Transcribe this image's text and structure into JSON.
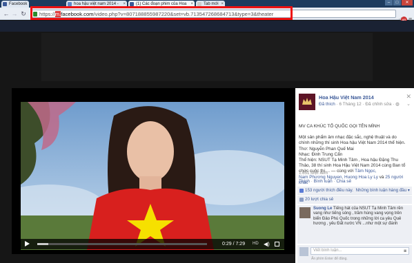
{
  "browser": {
    "tabs": [
      {
        "label": "Facebook",
        "active": false
      },
      {
        "label": "hoa hậu việt nam 2014 - ",
        "active": false
      },
      {
        "label": "(1) Các đoạn phim của Hoa",
        "active": true
      },
      {
        "label": "Tab mới",
        "active": false
      }
    ],
    "url": {
      "proto": "https://",
      "highlight": "m.",
      "host": "facebook.com",
      "path": "/video.php?v=807188855987220&set=vb.713547268684713&type=3&theater"
    },
    "ext_badge": "AR"
  },
  "video": {
    "timecode": "0:29 / 7:29",
    "progress_fraction": 0.065,
    "hd_label": "HD"
  },
  "panel": {
    "page_name": "Hoa Hậu Việt Nam 2014",
    "meta": {
      "liked": "Đã thích",
      "date": "6 Tháng 12",
      "edited": "Đã chỉnh sửa"
    },
    "title_line": "MV CA KHÚC TỔ QUỐC GỌI TÊN MÌNH",
    "lines": [
      "Một sản phẩm âm nhạc đặc sắc, nghệ thuật và do",
      "chính những thí sinh Hoa hậu Việt Nam 2014 thể hiện.",
      "Thơ: Nguyễn Phan Quế Mai",
      "Nhạc: Đinh Trung Cẩn",
      "Thể hiện: NSUT Tạ Minh Tâm , Hoa hậu Đặng Thu",
      "Thảo, 38 thí sinh Hoa Hậu Việt Nam 2014 cùng Ban tổ"
    ],
    "line7_plain": "chức cuộc thi.... — cùng với ",
    "line7_link": "Tâm Ngọc,",
    "line8_link": "Nam Phương Nguyen, Huong Hoa Ly Ly",
    "line8_plain": " và ",
    "line8_link2": "25 người",
    "line9_link": "khác",
    "views": "1.651 lượt xem",
    "actions": {
      "like": "Thích",
      "comment": "Bình luận",
      "share": "Chia sẻ"
    },
    "likes_line": "153 người thích điều này.",
    "sort_label": "Những bình luận hàng đầu",
    "shares_line": "20 lượt chia sẻ",
    "comment_author": "Suong Le",
    "comment_lines": [
      "Tiếng hát của NSUT Tạ Minh Tâm rền",
      "vang như tiếng sóng , trầm hùng vang vọng trên",
      "biển Đảo Phú Quốc trong những lời ca yêu Quê",
      "hương , yêu Đất nước VN ...như một sự đánh"
    ],
    "comment_placeholder": "Viết bình luận...",
    "enter_hint": "Ấn phím Enter để đăng."
  }
}
